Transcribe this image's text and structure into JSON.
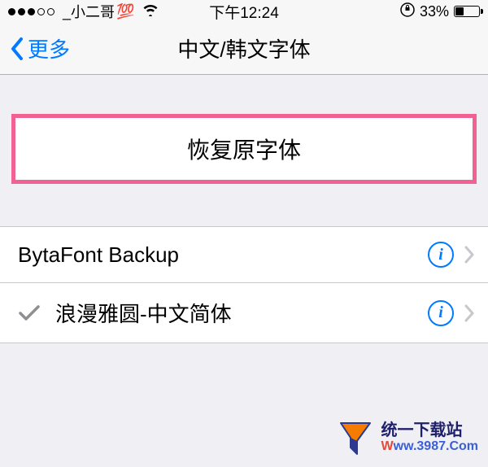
{
  "status": {
    "carrier": "_小二哥",
    "carrier_emoji": "💯",
    "time": "下午12:24",
    "lock_icon": "⟳",
    "battery_percent": "33%"
  },
  "nav": {
    "back_label": "更多",
    "title": "中文/韩文字体"
  },
  "restore": {
    "label": "恢复原字体"
  },
  "fonts": [
    {
      "name": "BytaFont Backup",
      "selected": false
    },
    {
      "name": "浪漫雅圆-中文简体",
      "selected": true
    }
  ],
  "watermark": {
    "title": "统一下载站",
    "url_w": "W",
    "url_rest": "ww.3987.Com"
  }
}
